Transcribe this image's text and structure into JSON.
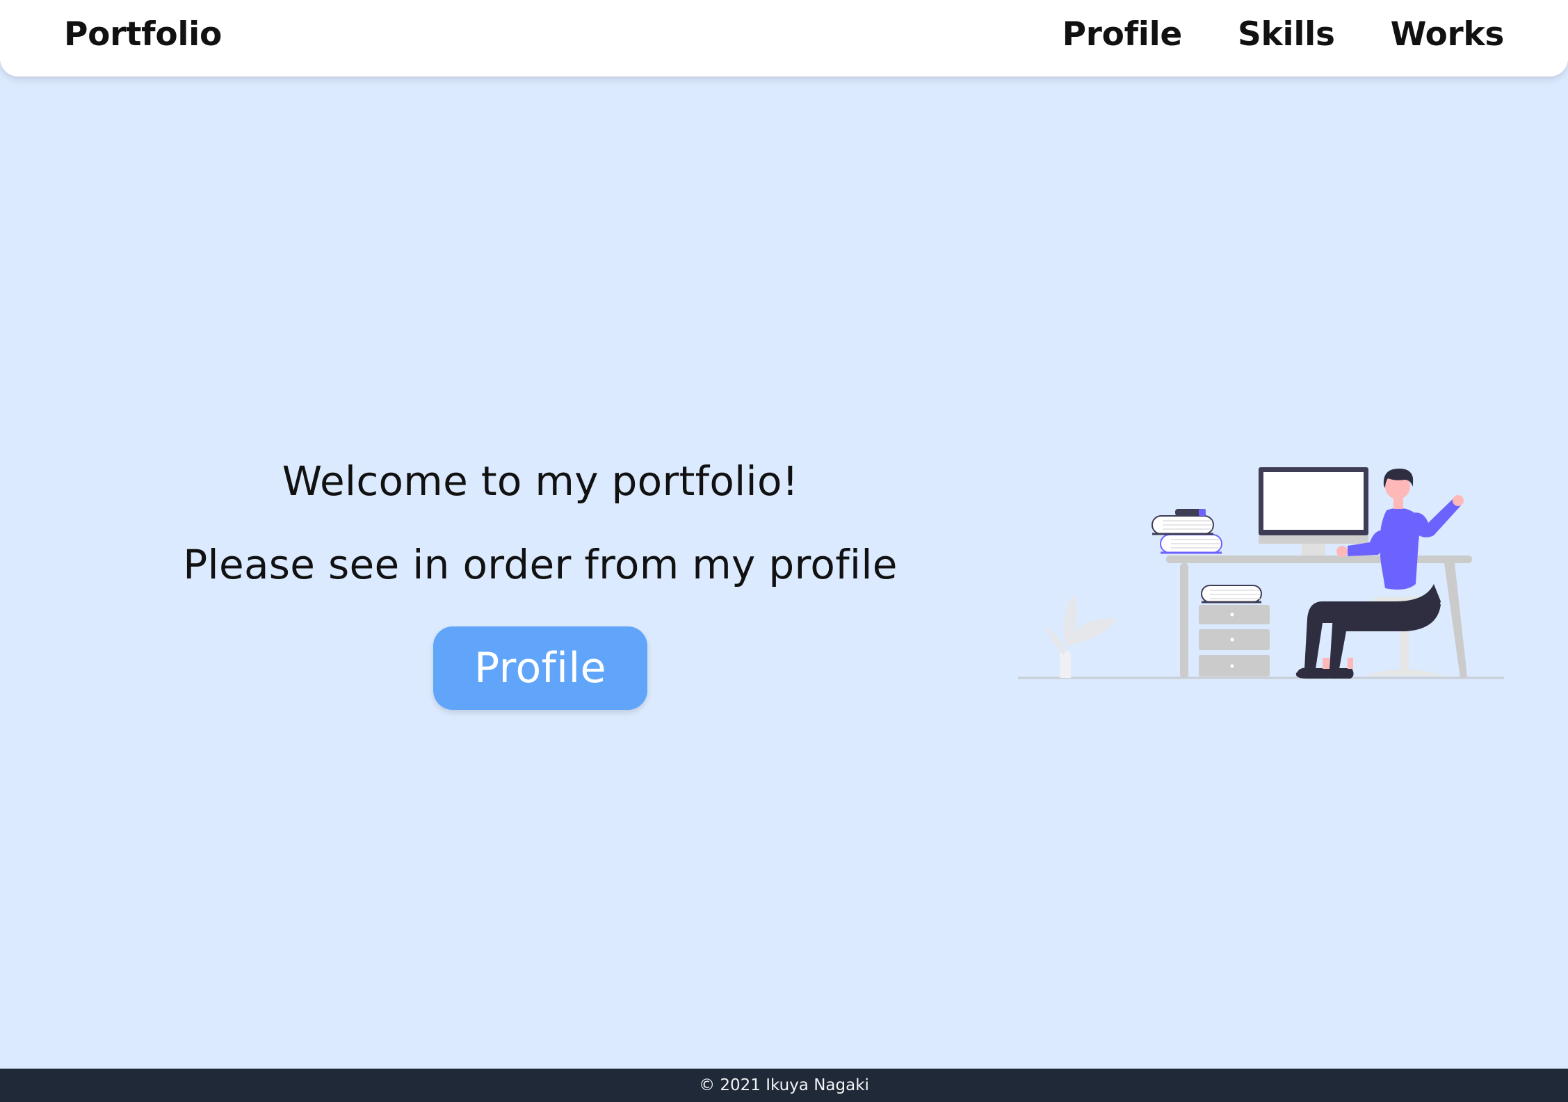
{
  "header": {
    "brand": "Portfolio",
    "nav": [
      "Profile",
      "Skills",
      "Works"
    ]
  },
  "hero": {
    "headline": "Welcome to my portfolio!",
    "subheadline": "Please see in order from my profile",
    "cta_label": "Profile"
  },
  "illustration": {
    "icon": "person-at-desk-illustration",
    "accent_color": "#6c63ff"
  },
  "footer": {
    "copyright": "© 2021 Ikuya Nagaki"
  },
  "colors": {
    "background": "#dbeafe",
    "header_bg": "#ffffff",
    "button": "#60a5fa",
    "footer": "#1f2937"
  }
}
